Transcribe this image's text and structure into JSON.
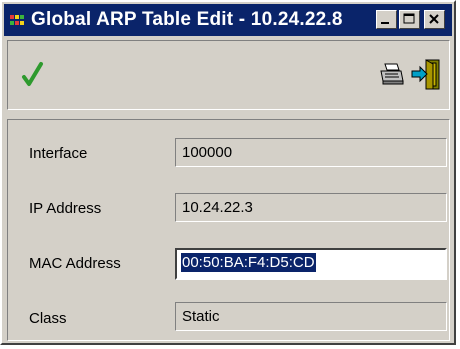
{
  "window": {
    "title": "Global ARP Table Edit - 10.24.22.8"
  },
  "toolbar": {
    "apply_icon": "checkmark-icon",
    "print_icon": "printer-icon",
    "exit_icon": "exit-door-icon"
  },
  "form": {
    "fields": [
      {
        "label": "Interface",
        "value": "100000",
        "editable": false
      },
      {
        "label": "IP Address",
        "value": "10.24.22.3",
        "editable": false
      },
      {
        "label": "MAC Address",
        "value": "00:50:BA:F4:D5:CD",
        "editable": true,
        "selected": true
      },
      {
        "label": "Class",
        "value": "Static",
        "editable": false
      }
    ]
  },
  "colors": {
    "titlebar": "#0a246a",
    "face": "#d4d0c8",
    "check_green": "#2e9a2e",
    "selection": "#0a246a"
  }
}
